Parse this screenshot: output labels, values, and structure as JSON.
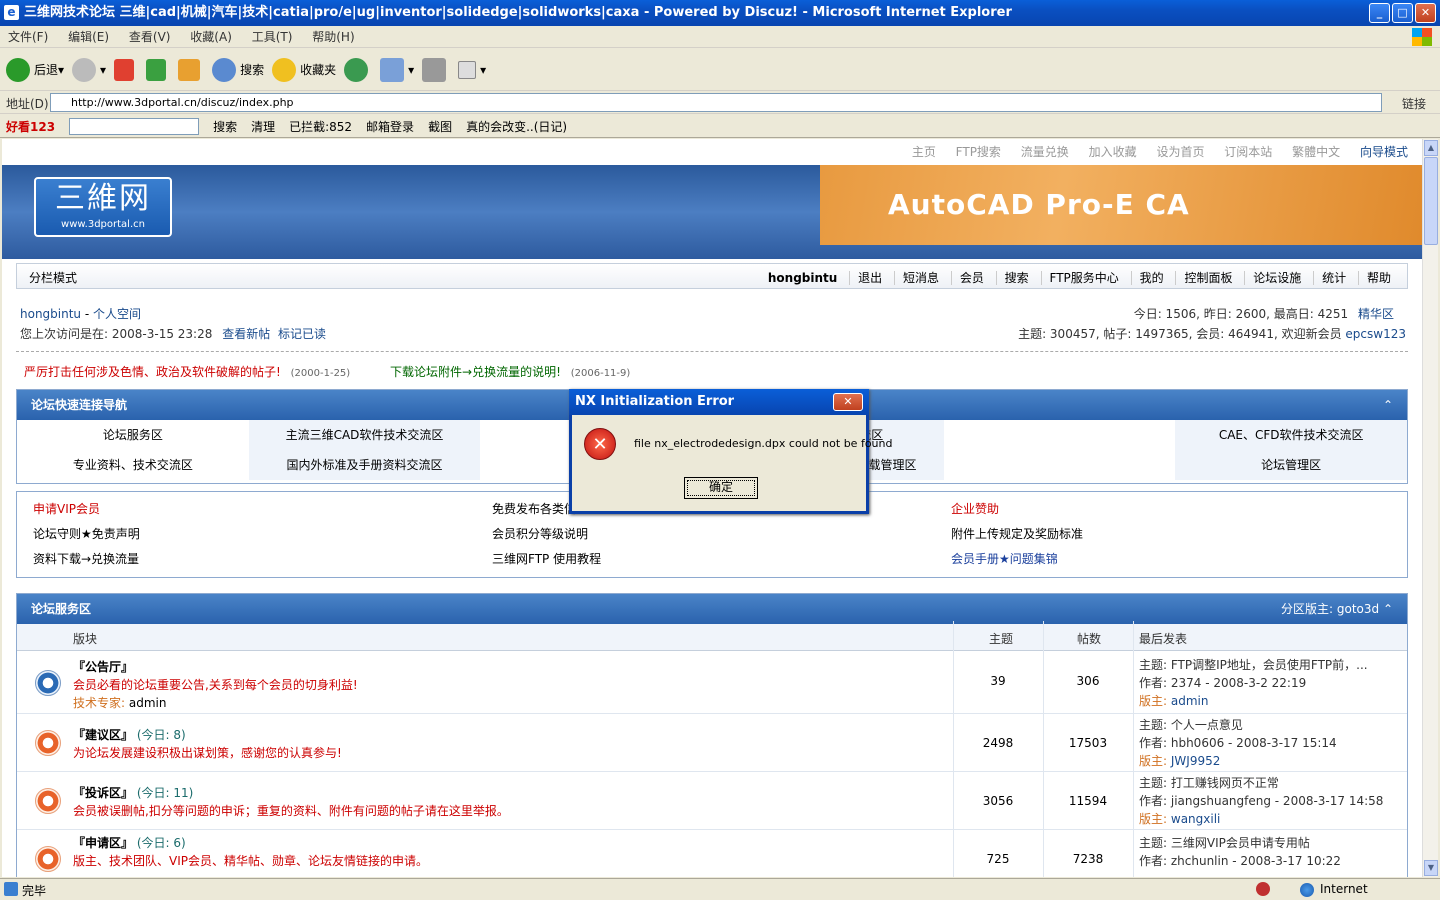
{
  "window": {
    "title": "三维网技术论坛 三维|cad|机械|汽车|技术|catia|pro/e|ug|inventor|solidedge|solidworks|caxa - Powered by Discuz! - Microsoft Internet Explorer",
    "min": "_",
    "max": "□",
    "close": "✕"
  },
  "menu": [
    "文件(F)",
    "编辑(E)",
    "查看(V)",
    "收藏(A)",
    "工具(T)",
    "帮助(H)"
  ],
  "toolbar": {
    "back": "后退",
    "search": "搜索",
    "favorites": "收藏夹"
  },
  "address": {
    "label": "地址(D)",
    "url": "http://www.3dportal.cn/discuz/index.php",
    "links": "链接"
  },
  "linksbar": {
    "brand": "好看123",
    "search": "搜索",
    "clean": "清理",
    "blocked": "已拦截:852",
    "mail": "邮箱登录",
    "screenshot": "截图",
    "news": "真的会改变..(日记)"
  },
  "site": {
    "toplinks": [
      "主页",
      "FTP搜索",
      "流量兑换",
      "加入收藏",
      "设为首页",
      "订阅本站",
      "繁體中文",
      "向导模式"
    ],
    "logo_big": "三維网",
    "logo_small": "www.3dportal.cn",
    "banner": "AutoCAD Pro-E CA",
    "split_mode": "分栏模式",
    "nav": [
      "hongbintu",
      "退出",
      "短消息",
      "会员",
      "搜索",
      "FTP服务中心",
      "我的",
      "控制面板",
      "论坛设施",
      "统计",
      "帮助"
    ],
    "user": "hongbintu",
    "space": "个人空间",
    "last_visit": "您上次访问是在: 2008-3-15 23:28",
    "new_posts": "查看新帖",
    "mark_read": "标记已读",
    "stats_line1": "今日: 1506, 昨日: 2600, 最高日: 4251",
    "digest": "精华区",
    "stats_line2": "主题: 300457, 帖子: 1497365, 会员: 464941, 欢迎新会员",
    "newest_member": "epcsw123"
  },
  "announcements": [
    {
      "text": "严厉打击任何涉及色情、政治及软件破解的帖子!",
      "date": "(2000-1-25)"
    },
    {
      "text": "下载论坛附件→兑换流量的说明!",
      "date": "(2006-11-9)"
    }
  ],
  "quicknav": {
    "title": "论坛快速连接导航",
    "cells": [
      "论坛服务区",
      "主流三维CAD软件技术交流区",
      "",
      "CAM软件技术交流区",
      "",
      "CAE、CFD软件技术交流区",
      "专业资料、技术交流区",
      "国内外标准及手册资料交流区",
      "",
      "FTP软件、资料上传及下载管理区",
      "",
      "论坛管理区"
    ]
  },
  "infolinks": [
    {
      "text": "申请VIP会员",
      "color": "#cc0000"
    },
    {
      "text": "免费发布各类信息",
      "color": "#000000"
    },
    {
      "text": "企业赞助",
      "color": "#cc0000"
    },
    {
      "text": "论坛守则★免责声明",
      "color": "#000000"
    },
    {
      "text": "会员积分等级说明",
      "color": "#000000"
    },
    {
      "text": "附件上传规定及奖励标准",
      "color": "#000000"
    },
    {
      "text": "资料下载→兑换流量",
      "color": "#000000"
    },
    {
      "text": "三维网FTP 使用教程",
      "color": "#000000"
    },
    {
      "text": "会员手册★问题集锦",
      "color": "#1a3f9c"
    }
  ],
  "forum": {
    "title": "论坛服务区",
    "moderator": "分区版主: goto3d",
    "cols": {
      "board": "版块",
      "topics": "主题",
      "posts": "帖数",
      "last": "最后发表"
    },
    "rows": [
      {
        "name": "『公告厅』",
        "today": "",
        "desc": "会员必看的论坛重要公告,关系到每个会员的切身利益!",
        "mod_label": "技术专家:",
        "mod": "admin",
        "topics": "39",
        "posts": "306",
        "last_topic": "主题: FTP调整IP地址，会员使用FTP前，...",
        "last_author": "作者: 2374 - 2008-3-2 22:19",
        "last_mod_label": "版主:",
        "last_mod": "admin"
      },
      {
        "name": "『建议区』",
        "today": "(今日: 8)",
        "desc": "为论坛发展建设积极出谋划策，感谢您的认真参与!",
        "mod_label": "",
        "mod": "",
        "topics": "2498",
        "posts": "17503",
        "last_topic": "主题: 个人一点意见",
        "last_author": "作者: hbh0606 - 2008-3-17 15:14",
        "last_mod_label": "版主:",
        "last_mod": "JWJ9952"
      },
      {
        "name": "『投诉区』",
        "today": "(今日: 11)",
        "desc": "会员被误删帖,扣分等问题的申诉；重复的资料、附件有问题的帖子请在这里举报。",
        "mod_label": "",
        "mod": "",
        "topics": "3056",
        "posts": "11594",
        "last_topic": "主题: 打工赚钱网页不正常",
        "last_author": "作者: jiangshuangfeng - 2008-3-17 14:58",
        "last_mod_label": "版主:",
        "last_mod": "wangxili"
      },
      {
        "name": "『申请区』",
        "today": "(今日: 6)",
        "desc": "版主、技术团队、VIP会员、精华帖、勋章、论坛友情链接的申请。",
        "mod_label": "",
        "mod": "",
        "topics": "725",
        "posts": "7238",
        "last_topic": "主题: 三维网VIP会员申请专用帖",
        "last_author": "作者: zhchunlin - 2008-3-17 10:22",
        "last_mod_label": "",
        "last_mod": ""
      }
    ]
  },
  "dialog": {
    "title": "NX Initialization Error",
    "close": "✕",
    "message": "file nx_electrodedesign.dpx could not be found",
    "ok": "确定"
  },
  "status": {
    "text": "完毕",
    "zone": "Internet"
  }
}
